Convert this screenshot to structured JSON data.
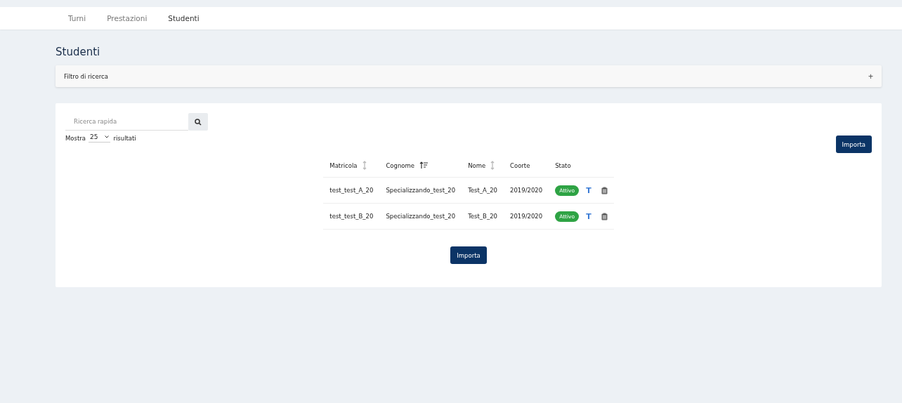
{
  "nav": {
    "items": [
      {
        "label": "Turni",
        "selected": false
      },
      {
        "label": "Prestazioni",
        "selected": false
      },
      {
        "label": "Studenti",
        "selected": true
      }
    ]
  },
  "page_title": "Studenti",
  "filter": {
    "label": "Filtro di ricerca",
    "toggle": "+"
  },
  "search": {
    "placeholder": "Ricerca rapida"
  },
  "page_size": {
    "before": "Mostra",
    "value": "25",
    "after": "risultati"
  },
  "import_button_top": "Importa",
  "table": {
    "columns": [
      {
        "label": "Matricola",
        "kind": "sortable"
      },
      {
        "label": "Cognome",
        "kind": "sorted"
      },
      {
        "label": "Nome",
        "kind": "sortable"
      },
      {
        "label": "Coorte"
      },
      {
        "label": "Stato"
      }
    ],
    "rows": [
      {
        "matricola": "test_test_A_20",
        "cognome": "Specializzando_test_20",
        "nome": "Test_A_20",
        "coorte": "2019/2020",
        "stato": "Attivo",
        "action": "T"
      },
      {
        "matricola": "test_test_B_20",
        "cognome": "Specializzando_test_20",
        "nome": "Test_B_20",
        "coorte": "2019/2020",
        "stato": "Attivo",
        "action": "T"
      }
    ]
  },
  "import_button_bottom": "Importa"
}
